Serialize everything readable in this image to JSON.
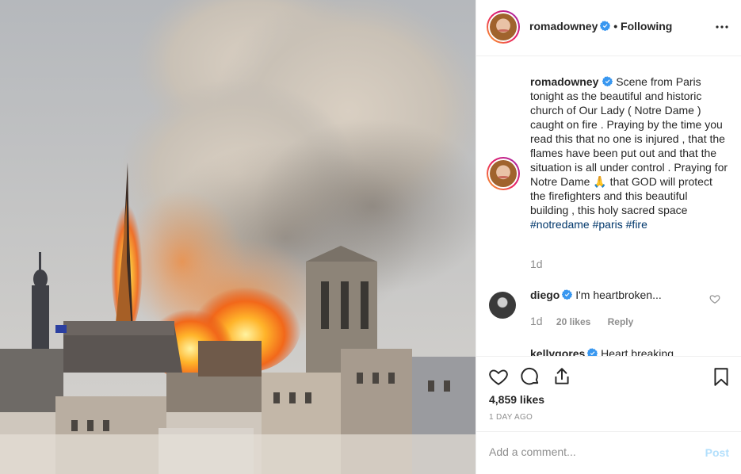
{
  "post": {
    "author": "romadowney",
    "follow_label": "• Following",
    "more_icon": "more-options-icon",
    "photo_alt_icon": "notre-dame-fire-photo",
    "caption": {
      "username": "romadowney",
      "text": "Scene from Paris tonight as the beautiful and historic church of Our Lady ( Notre Dame ) caught on fire . Praying by the time you read this that no one is injured , that the flames have been put out and that the situation is all under control . Praying for Notre Dame 🙏 that GOD will protect the firefighters and this beautiful building , this holy sacred space",
      "hashtags": [
        "#notredame",
        "#paris",
        "#fire"
      ],
      "time": "1d"
    },
    "comments": [
      {
        "username": "diego",
        "text": "I'm heartbroken...",
        "time": "1d",
        "likes": "20 likes",
        "reply_label": "Reply"
      },
      {
        "username": "kellygores",
        "text": "Heart breaking"
      }
    ],
    "likes": "4,859 likes",
    "posted_ago": "1 DAY AGO",
    "add_comment": {
      "placeholder": "Add a comment...",
      "post_label": "Post"
    }
  },
  "colors": {
    "verified": "#3897f0",
    "hashtag": "#00376b",
    "post_button_disabled": "#b2dffc",
    "muted": "#8e8e8e"
  }
}
